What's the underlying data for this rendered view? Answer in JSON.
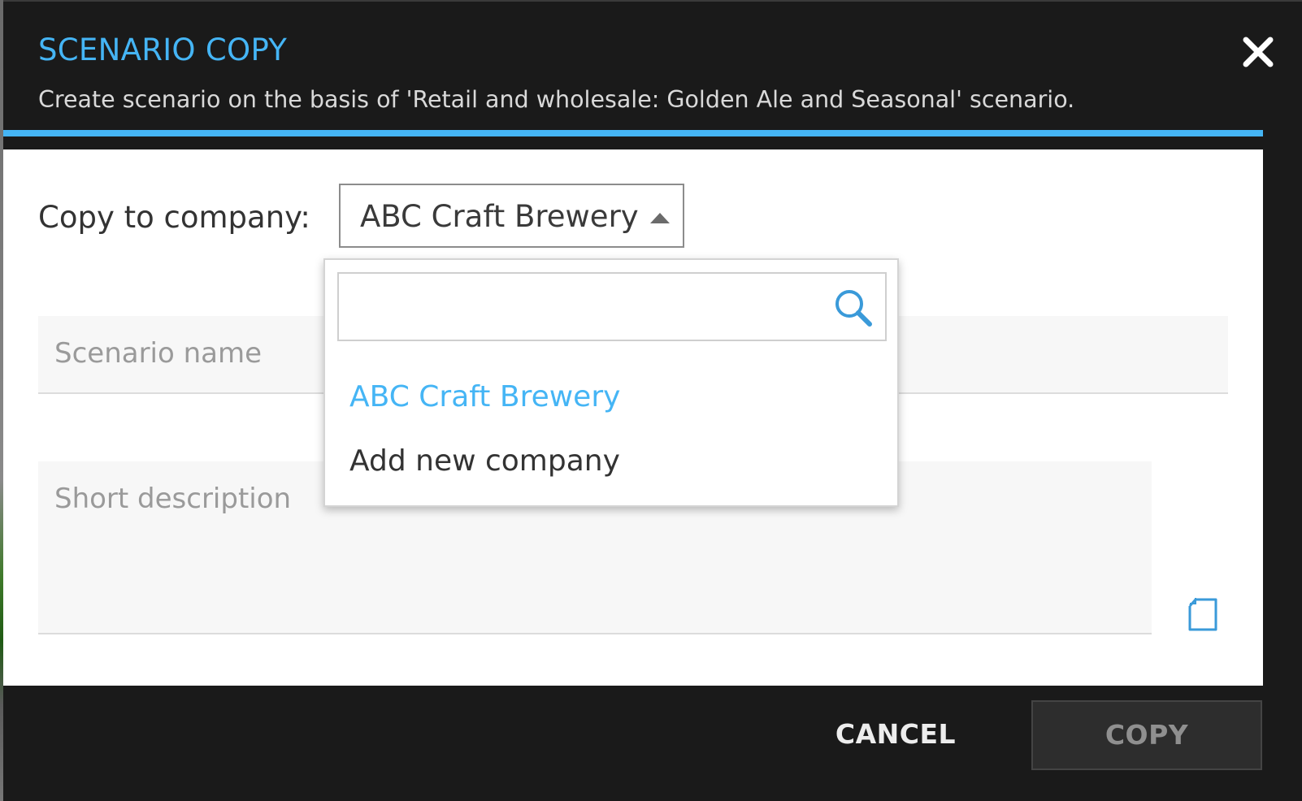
{
  "dialog": {
    "title": "SCENARIO COPY",
    "subtitle": "Create scenario on the basis of 'Retail and wholesale: Golden Ale and Seasonal' scenario."
  },
  "form": {
    "company_label": "Copy to company:",
    "company_selected": "ABC Craft Brewery",
    "scenario_name_placeholder": "Scenario name",
    "description_placeholder": "Short description"
  },
  "dropdown": {
    "search_value": "",
    "options": [
      {
        "label": "ABC Craft Brewery",
        "selected": true
      },
      {
        "label": "Add new company",
        "selected": false
      }
    ]
  },
  "footer": {
    "cancel_label": "CANCEL",
    "copy_label": "COPY"
  },
  "icons": {
    "close": "close-icon",
    "search": "search-icon",
    "caret": "caret-up-icon",
    "expand": "expand-editor-icon"
  },
  "colors": {
    "accent": "#45b5f5",
    "header_bg": "#1a1a1a",
    "body_bg": "#ffffff",
    "copy_button_bg": "#2d2d2d"
  }
}
